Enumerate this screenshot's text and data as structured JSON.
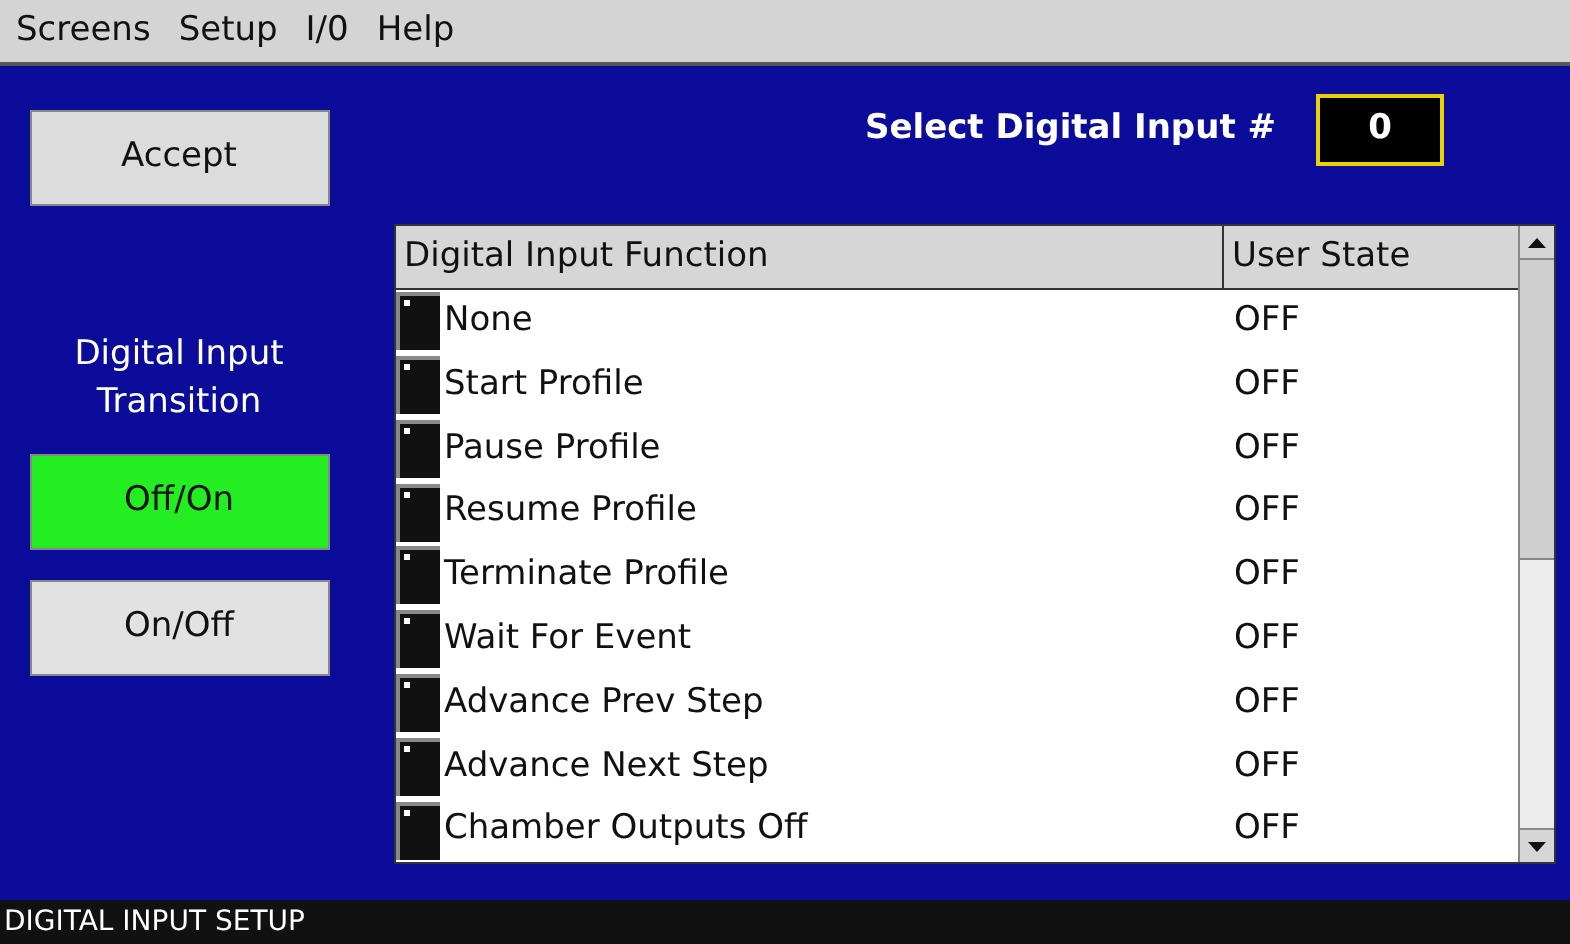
{
  "menu": [
    "Screens",
    "Setup",
    "I/0",
    "Help"
  ],
  "accept_button": "Accept",
  "select_input": {
    "label": "Select Digital Input #",
    "value": "0"
  },
  "transition": {
    "label": "Digital Input Transition",
    "options": [
      {
        "label": "Off/On",
        "selected": true
      },
      {
        "label": "On/Off",
        "selected": false
      }
    ]
  },
  "table": {
    "columns": [
      "Digital Input Function",
      "User State"
    ],
    "rows": [
      {
        "function": "None",
        "state": "OFF"
      },
      {
        "function": "Start Profile",
        "state": "OFF"
      },
      {
        "function": "Pause Profile",
        "state": "OFF"
      },
      {
        "function": "Resume Profile",
        "state": "OFF"
      },
      {
        "function": "Terminate Profile",
        "state": "OFF"
      },
      {
        "function": "Wait For Event",
        "state": "OFF"
      },
      {
        "function": "Advance Prev Step",
        "state": "OFF"
      },
      {
        "function": "Advance Next Step",
        "state": "OFF"
      },
      {
        "function": "Chamber Outputs Off",
        "state": "OFF"
      }
    ]
  },
  "status_bar": "DIGITAL INPUT SETUP"
}
